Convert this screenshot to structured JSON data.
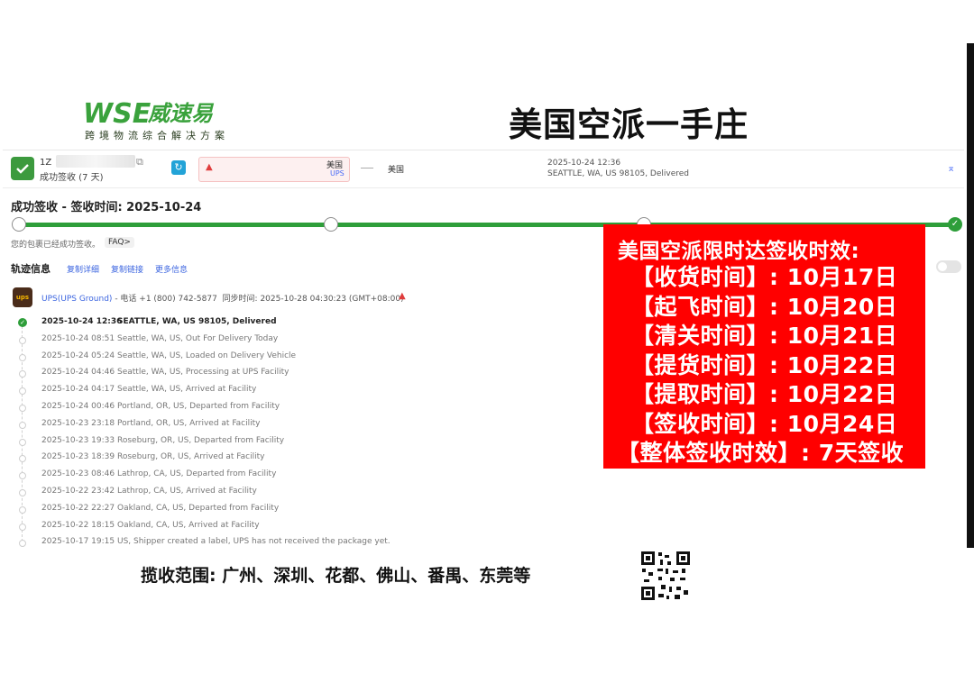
{
  "brand": {
    "logo_text": "WSE威速易",
    "tagline": "跨境物流综合解决方案",
    "headline": "美国空派一手庄"
  },
  "shipment": {
    "tracking_prefix": "1Z",
    "status_short": "成功签收 (7 天)",
    "origin_country": "美国",
    "carrier_tag": "UPS",
    "destination_country": "美国",
    "latest_time": "2025-10-24 12:36",
    "latest_location": "SEATTLE, WA, US 98105, Delivered"
  },
  "progress": {
    "title": "成功签收 - 签收时间: 2025-10-24",
    "message": "您的包裹已经成功签收。",
    "faq": "FAQ>"
  },
  "tracking_section": {
    "title": "轨迹信息",
    "links": [
      "复制详细",
      "复制链接",
      "更多信息"
    ]
  },
  "carrier_info": {
    "logo": "ups",
    "name": "UPS(UPS Ground)",
    "phone": " - 电话 +1 (800) 742-5877",
    "sync": "同步时间: 2025-10-28 04:30:23 (GMT+08:00)"
  },
  "events": [
    {
      "time": "2025-10-24 12:36",
      "desc": "SEATTLE, WA, US 98105, Delivered"
    },
    {
      "time": "2025-10-24 08:51",
      "desc": "Seattle, WA, US, Out For Delivery Today"
    },
    {
      "time": "2025-10-24 05:24",
      "desc": "Seattle, WA, US, Loaded on Delivery Vehicle"
    },
    {
      "time": "2025-10-24 04:46",
      "desc": "Seattle, WA, US, Processing at UPS Facility"
    },
    {
      "time": "2025-10-24 04:17",
      "desc": "Seattle, WA, US, Arrived at Facility"
    },
    {
      "time": "2025-10-24 00:46",
      "desc": "Portland, OR, US, Departed from Facility"
    },
    {
      "time": "2025-10-23 23:18",
      "desc": "Portland, OR, US, Arrived at Facility"
    },
    {
      "time": "2025-10-23 19:33",
      "desc": "Roseburg, OR, US, Departed from Facility"
    },
    {
      "time": "2025-10-23 18:39",
      "desc": "Roseburg, OR, US, Arrived at Facility"
    },
    {
      "time": "2025-10-23 08:46",
      "desc": "Lathrop, CA, US, Departed from Facility"
    },
    {
      "time": "2025-10-22 23:42",
      "desc": "Lathrop, CA, US, Arrived at Facility"
    },
    {
      "time": "2025-10-22 22:27",
      "desc": "Oakland, CA, US, Departed from Facility"
    },
    {
      "time": "2025-10-22 18:15",
      "desc": "Oakland, CA, US, Arrived at Facility"
    },
    {
      "time": "2025-10-17 19:15",
      "desc": "US, Shipper created a label, UPS has not received the package yet."
    }
  ],
  "promo": {
    "title": "美国空派限时达签收时效:",
    "rows": [
      "【收货时间】: 10月17日",
      "【起飞时间】: 10月20日",
      "【清关时间】: 10月21日",
      "【提货时间】: 10月22日",
      "【提取时间】: 10月22日",
      "【签收时间】: 10月24日",
      "【整体签收时效】: 7天签收"
    ]
  },
  "footer": {
    "coverage": "揽收范围: 广州、深圳、花都、佛山、番禺、东莞等"
  },
  "colors": {
    "brand_green": "#3aa23c",
    "progress_green": "#2e9e3a",
    "promo_red": "#ff0000",
    "link_blue": "#3d66e0",
    "alert_red": "#e03c3c"
  }
}
